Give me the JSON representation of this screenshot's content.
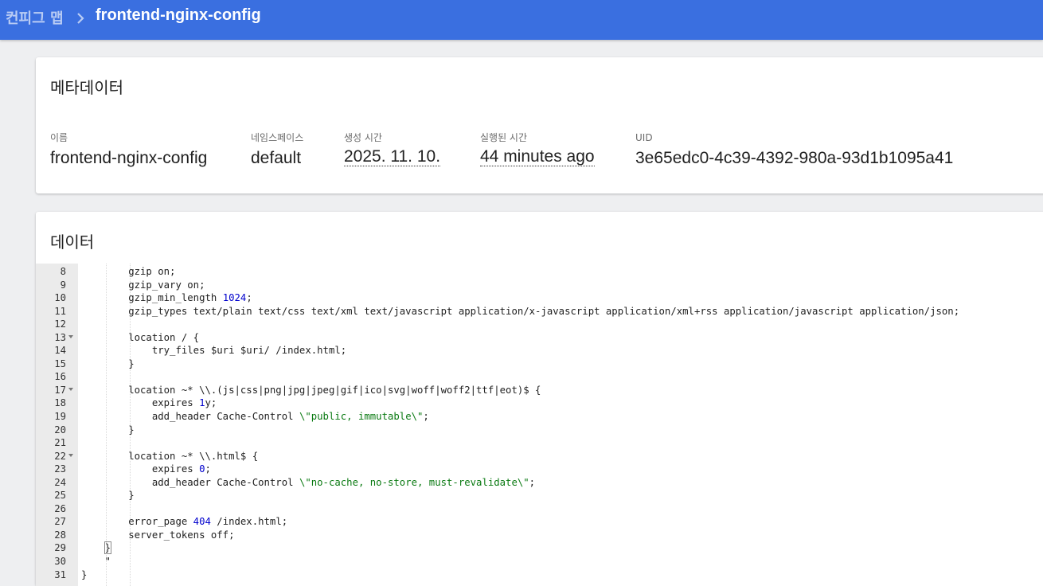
{
  "breadcrumb": {
    "root": "컨피그 맵",
    "current": "frontend-nginx-config"
  },
  "metadata": {
    "title": "메타데이터",
    "fields": {
      "name": {
        "label": "이름",
        "value": "frontend-nginx-config"
      },
      "namespace": {
        "label": "네임스페이스",
        "value": "default"
      },
      "created": {
        "label": "생성 시간",
        "value": "2025. 11. 10."
      },
      "age": {
        "label": "실행된 시간",
        "value": "44 minutes ago"
      },
      "uid": {
        "label": "UID",
        "value": "3e65edc0-4c39-4392-980a-93d1b1095a41"
      }
    }
  },
  "data_section": {
    "title": "데이터",
    "editor_lines": [
      {
        "n": "8",
        "fold": false,
        "text": "        gzip on;"
      },
      {
        "n": "9",
        "fold": false,
        "text": "        gzip_vary on;"
      },
      {
        "n": "10",
        "fold": false,
        "text": "        gzip_min_length 1024;"
      },
      {
        "n": "11",
        "fold": false,
        "text": "        gzip_types text/plain text/css text/xml text/javascript application/x-javascript application/xml+rss application/javascript application/json;"
      },
      {
        "n": "12",
        "fold": false,
        "text": ""
      },
      {
        "n": "13",
        "fold": true,
        "text": "        location / {"
      },
      {
        "n": "14",
        "fold": false,
        "text": "            try_files $uri $uri/ /index.html;"
      },
      {
        "n": "15",
        "fold": false,
        "text": "        }"
      },
      {
        "n": "16",
        "fold": false,
        "text": ""
      },
      {
        "n": "17",
        "fold": true,
        "text": "        location ~* \\\\.(js|css|png|jpg|jpeg|gif|ico|svg|woff|woff2|ttf|eot)$ {"
      },
      {
        "n": "18",
        "fold": false,
        "text": "            expires 1y;"
      },
      {
        "n": "19",
        "fold": false,
        "text": "            add_header Cache-Control \\\"public, immutable\\\";"
      },
      {
        "n": "20",
        "fold": false,
        "text": "        }"
      },
      {
        "n": "21",
        "fold": false,
        "text": ""
      },
      {
        "n": "22",
        "fold": true,
        "text": "        location ~* \\\\.html$ {"
      },
      {
        "n": "23",
        "fold": false,
        "text": "            expires 0;"
      },
      {
        "n": "24",
        "fold": false,
        "text": "            add_header Cache-Control \\\"no-cache, no-store, must-revalidate\\\";"
      },
      {
        "n": "25",
        "fold": false,
        "text": "        }"
      },
      {
        "n": "26",
        "fold": false,
        "text": ""
      },
      {
        "n": "27",
        "fold": false,
        "text": "        error_page 404 /index.html;"
      },
      {
        "n": "28",
        "fold": false,
        "text": "        server_tokens off;"
      },
      {
        "n": "29",
        "fold": false,
        "text": "    }"
      },
      {
        "n": "30",
        "fold": false,
        "text": "    \""
      },
      {
        "n": "31",
        "fold": false,
        "text": "}"
      }
    ]
  },
  "colors": {
    "topbar": "#3a6fe0",
    "page_bg": "#eeeff1",
    "code_number": "#0000cd",
    "code_string": "#0a7a12"
  }
}
